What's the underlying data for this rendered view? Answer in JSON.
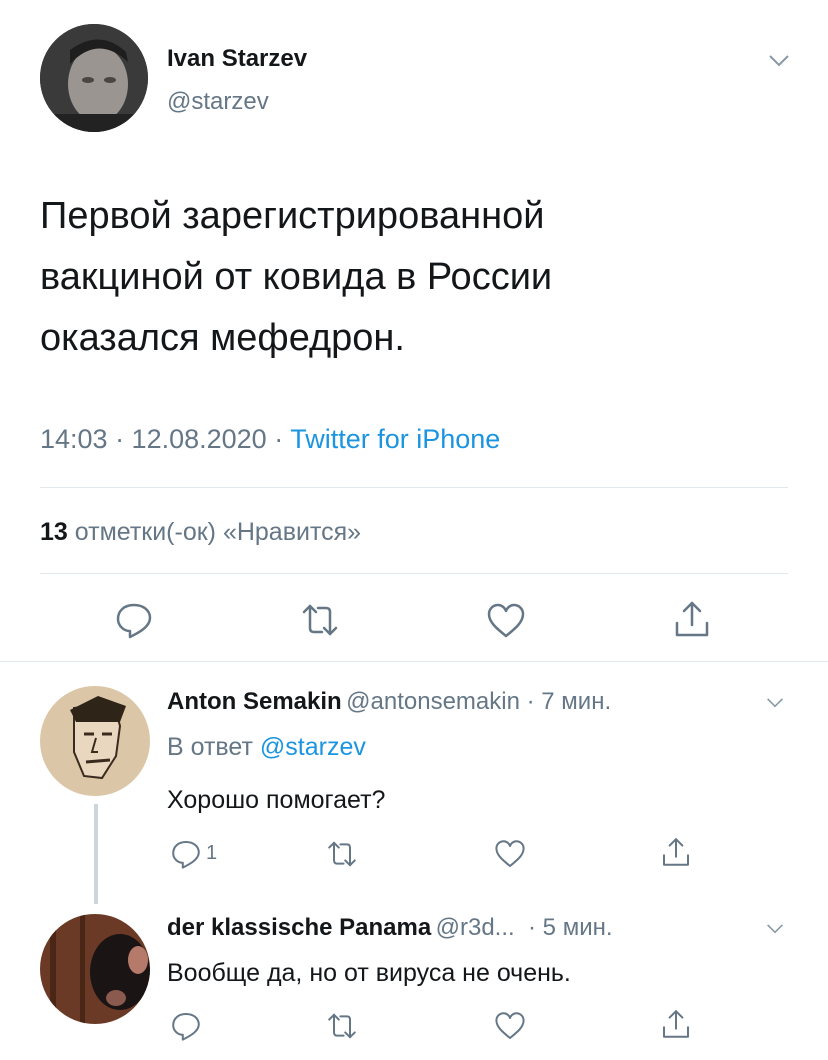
{
  "tweet": {
    "author_name": "Ivan Starzev",
    "author_handle": "@starzev",
    "text_lines": [
      "Первой зарегистрированной",
      "вакциной от ковида в России",
      "оказался мефедрон."
    ],
    "time": "14:03 · 12.08.2020 ·",
    "source": "Twitter for iPhone",
    "likes_count": "13",
    "likes_label": "отметки(-ок) «Нравится»"
  },
  "replies": [
    {
      "name": "Anton Semakin",
      "handle_time": "@antonsemakin · 7 мин.",
      "reply_to_label": "В ответ",
      "reply_to_handle": "@starzev",
      "text": "Хорошо помогает?",
      "reply_count": "1"
    },
    {
      "name": "der klassische Panama",
      "handle_time": "@r3d...  · 5 мин.",
      "text": "Вообще да, но от вируса не очень."
    }
  ],
  "icons": {
    "menu": "chevron-down-icon",
    "reply": "reply-icon",
    "retweet": "retweet-icon",
    "like": "heart-icon",
    "share": "share-icon"
  },
  "colors": {
    "accent": "#1b95e0",
    "muted": "#657786",
    "text": "#14171a",
    "divider": "#e1e8ed"
  }
}
